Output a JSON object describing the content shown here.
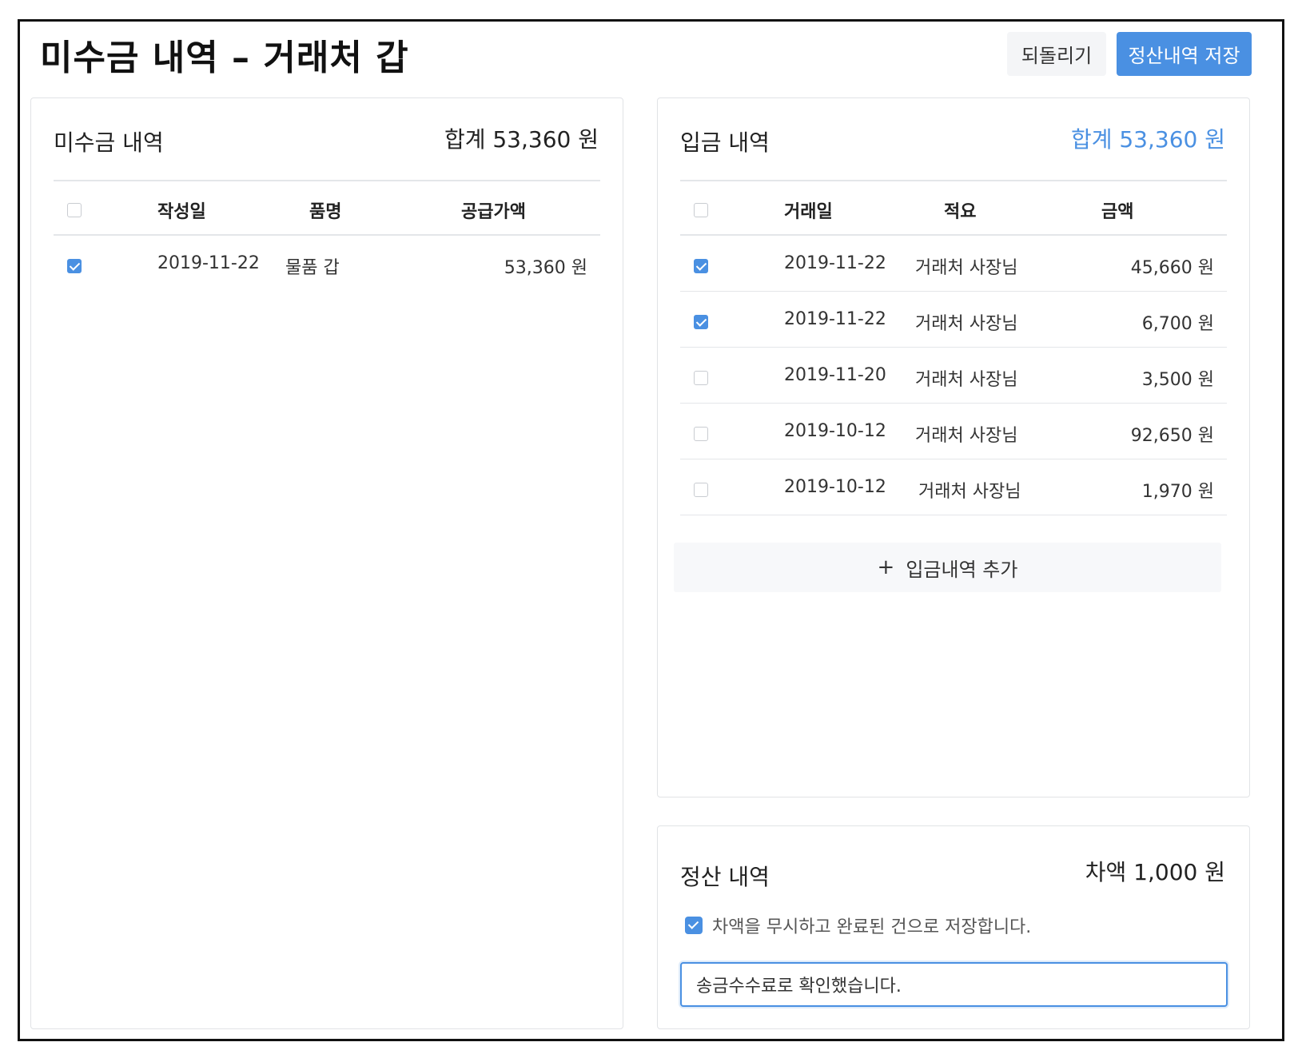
{
  "header": {
    "title": "미수금 내역 – 거래처 갑",
    "revert_label": "되돌리기",
    "save_label": "정산내역 저장"
  },
  "receivables": {
    "title": "미수금 내역",
    "total": "합계 53,360 원",
    "columns": [
      "작성일",
      "품명",
      "공급가액"
    ],
    "rows": [
      {
        "checked": true,
        "date": "2019-11-22",
        "item": "물품 갑",
        "amount": "53,360 원"
      }
    ]
  },
  "deposits": {
    "title": "입금 내역",
    "total": "합계 53,360 원",
    "columns": [
      "거래일",
      "적요",
      "금액"
    ],
    "rows": [
      {
        "checked": true,
        "date": "2019-11-22",
        "memo": "거래처 사장님",
        "amount": "45,660 원"
      },
      {
        "checked": true,
        "date": "2019-11-22",
        "memo": "거래처 사장님",
        "amount": "6,700 원"
      },
      {
        "checked": false,
        "date": "2019-11-20",
        "memo": "거래처 사장님",
        "amount": "3,500 원"
      },
      {
        "checked": false,
        "date": "2019-10-12",
        "memo": "거래처 사장님",
        "amount": "92,650 원"
      },
      {
        "checked": false,
        "date": "2019-10-12",
        "memo": "거래처 사장님",
        "amount": "1,970 원"
      }
    ],
    "add_label": "입금내역 추가",
    "add_icon": "plus-icon"
  },
  "settlement": {
    "title": "정산 내역",
    "difference": "차액 1,000 원",
    "ignore_checked": true,
    "ignore_label": "차액을 무시하고 완료된 건으로 저장합니다.",
    "memo_value": "송금수수료로 확인했습니다."
  },
  "colors": {
    "accent": "#4a90e2",
    "border": "#e1e3e6"
  }
}
